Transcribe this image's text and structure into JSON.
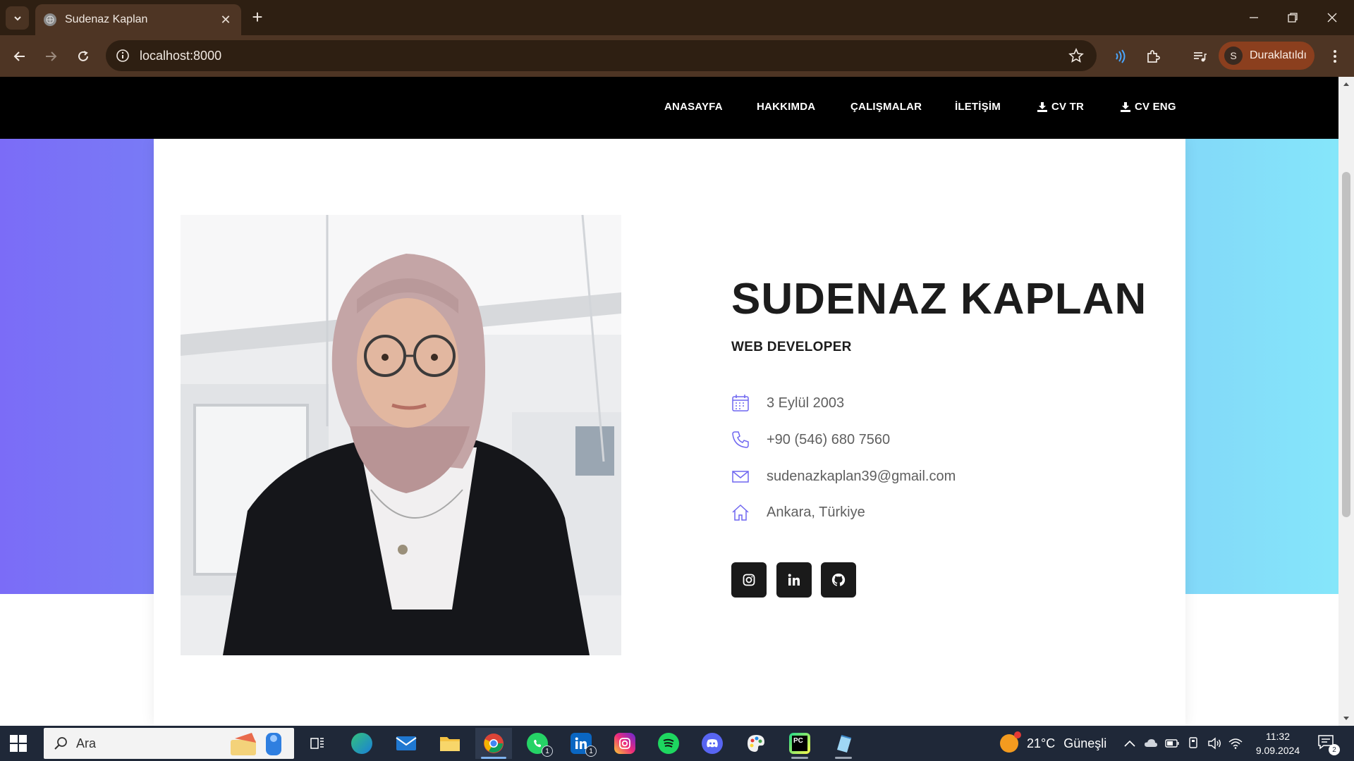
{
  "browser": {
    "tab_title": "Sudenaz Kaplan",
    "url": "localhost:8000",
    "profile_initial": "S",
    "profile_label": "Duraklatıldı",
    "new_tab_glyph": "+",
    "close_tab_glyph": "✕"
  },
  "nav": {
    "links": [
      "ANASAYFA",
      "HAKKIMDA",
      "ÇALIŞMALAR",
      "İLETİŞİM"
    ],
    "cv_tr": "CV TR",
    "cv_eng": "CV ENG"
  },
  "profile": {
    "name": "SUDENAZ KAPLAN",
    "role": "WEB DEVELOPER",
    "birthdate": "3 Eylül 2003",
    "phone": "+90 (546) 680 7560",
    "email": "sudenazkaplan39@gmail.com",
    "location": "Ankara, Türkiye",
    "icon_color": "#6f66f0",
    "social": [
      "instagram-icon",
      "linkedin-icon",
      "github-icon"
    ]
  },
  "theme": {
    "gradient_left": "#7b6cf7",
    "gradient_right": "#85e6fa",
    "navbar_bg": "#000000"
  },
  "taskbar": {
    "search_placeholder": "Ara",
    "whatsapp_badge": "1",
    "linkedin_badge": "1",
    "weather_temp": "21°C",
    "weather_desc": "Güneşli",
    "time": "11:32",
    "date": "9.09.2024",
    "notifications": "2"
  }
}
